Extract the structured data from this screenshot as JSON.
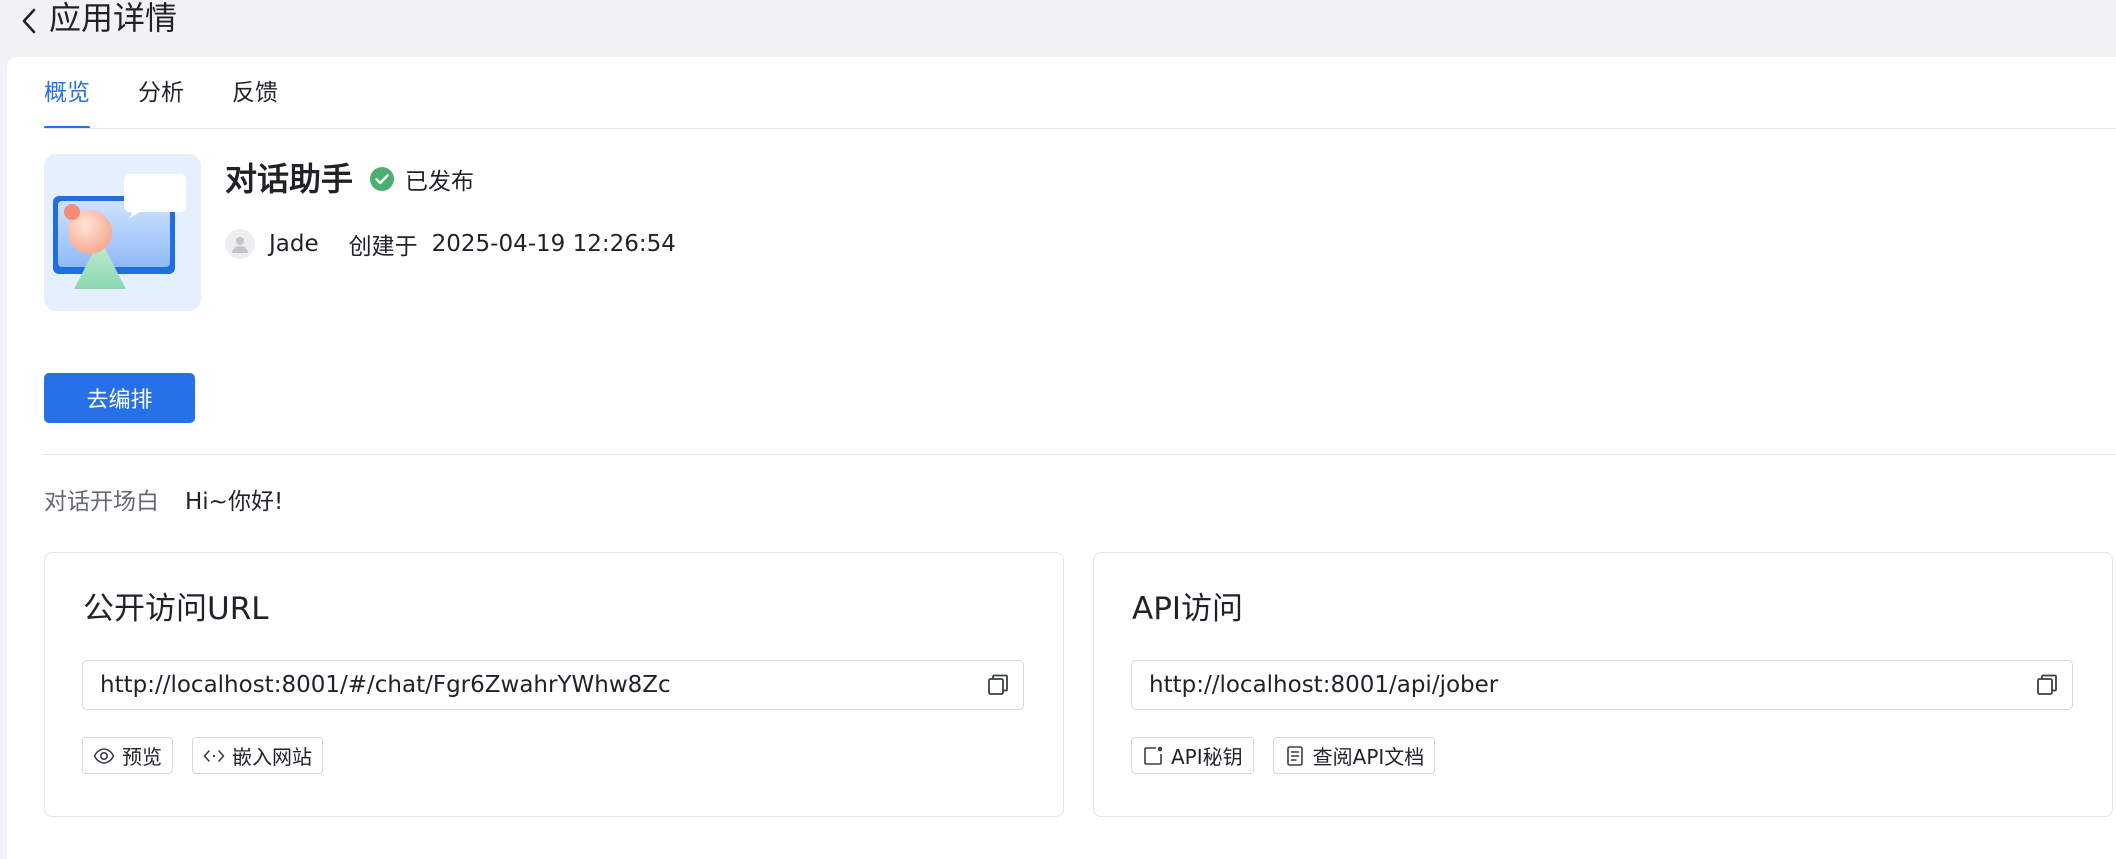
{
  "header": {
    "title": "应用详情"
  },
  "tabs": [
    {
      "label": "概览",
      "active": true
    },
    {
      "label": "分析",
      "active": false
    },
    {
      "label": "反馈",
      "active": false
    }
  ],
  "app": {
    "name": "对话助手",
    "status": "已发布",
    "status_color": "#4caf6e",
    "author": "Jade",
    "created_label": "创建于",
    "created_at": "2025-04-19 12:26:54"
  },
  "actions": {
    "edit_label": "去编排"
  },
  "greeting": {
    "label": "对话开场白",
    "value": "Hi~你好!"
  },
  "public_access": {
    "title": "公开访问URL",
    "url": "http://localhost:8001/#/chat/Fgr6ZwahrYWhw8Zc",
    "buttons": [
      {
        "label": "预览",
        "icon": "eye-icon"
      },
      {
        "label": "嵌入网站",
        "icon": "code-icon"
      }
    ]
  },
  "api_access": {
    "title": "API访问",
    "url": "http://localhost:8001/api/jober",
    "buttons": [
      {
        "label": "API秘钥",
        "icon": "key-icon"
      },
      {
        "label": "查阅API文档",
        "icon": "document-icon"
      }
    ]
  },
  "colors": {
    "accent": "#2670e8",
    "background": "#f1f2f6"
  }
}
